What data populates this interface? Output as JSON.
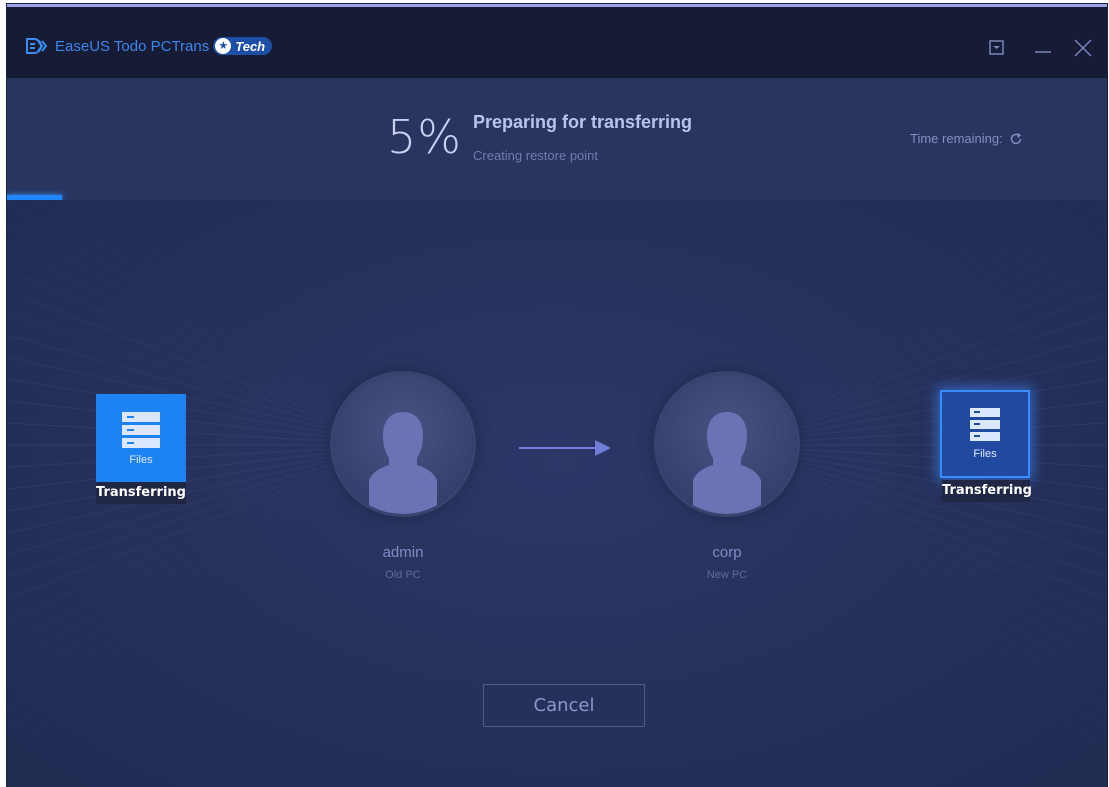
{
  "app": {
    "title": "EaseUS Todo PCTrans",
    "badge": "Tech"
  },
  "window_controls": [
    "minimize-to-tray",
    "minimize",
    "close"
  ],
  "progress": {
    "percent_text": "5%",
    "percent_value": 5,
    "title": "Preparing for transferring",
    "subtitle": "Creating restore point",
    "time_remaining_label": "Time remaining:"
  },
  "source": {
    "name": "admin",
    "role": "Old PC",
    "files_label": "Files",
    "status": "Transferring"
  },
  "target": {
    "name": "corp",
    "role": "New PC",
    "files_label": "Files",
    "status": "Transferring"
  },
  "cancel_label": "Cancel",
  "colors": {
    "accent": "#1f86ff",
    "background": "#26305a",
    "titlebar": "#161c36"
  }
}
